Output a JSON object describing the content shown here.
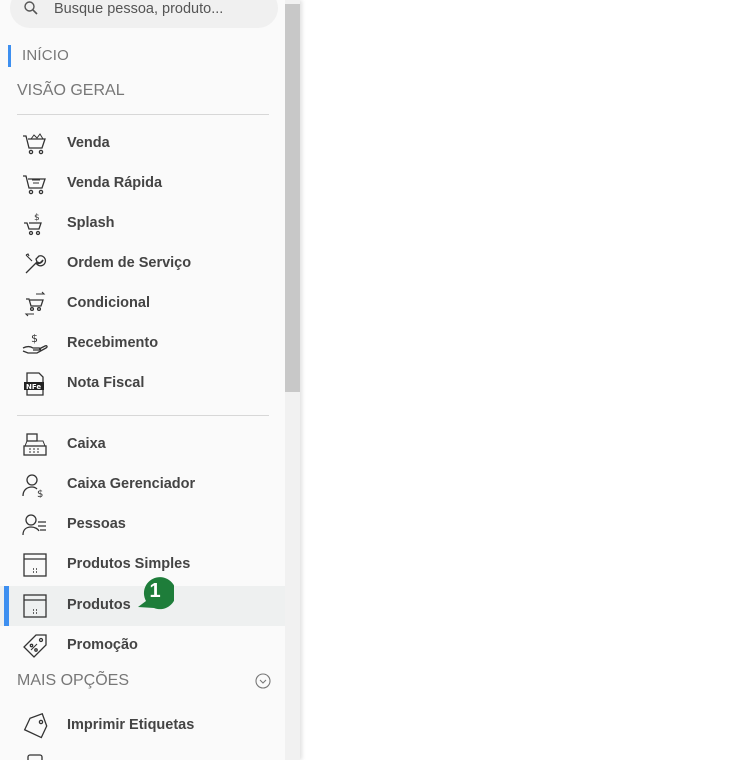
{
  "search": {
    "placeholder": "Busque pessoa, produto..."
  },
  "nav": {
    "inicio": "INÍCIO"
  },
  "sections": {
    "visao_geral": "VISÃO GERAL",
    "mais_opcoes": "MAIS OPÇÕES"
  },
  "group1": [
    {
      "label": "Venda",
      "icon": "cart-icon"
    },
    {
      "label": "Venda Rápida",
      "icon": "cart-fast-icon"
    },
    {
      "label": "Splash",
      "icon": "cart-dollar-icon"
    },
    {
      "label": "Ordem de Serviço",
      "icon": "wrench-icon"
    },
    {
      "label": "Condicional",
      "icon": "cart-exchange-icon"
    },
    {
      "label": "Recebimento",
      "icon": "hand-dollar-icon"
    },
    {
      "label": "Nota Fiscal",
      "icon": "nfe-icon"
    }
  ],
  "group2": [
    {
      "label": "Caixa",
      "icon": "cash-register-icon"
    },
    {
      "label": "Caixa Gerenciador",
      "icon": "user-dollar-icon"
    },
    {
      "label": "Pessoas",
      "icon": "user-list-icon"
    },
    {
      "label": "Produtos Simples",
      "icon": "box-icon"
    },
    {
      "label": "Produtos",
      "icon": "box-icon"
    },
    {
      "label": "Promoção",
      "icon": "tag-percent-icon"
    }
  ],
  "group3": [
    {
      "label": "Imprimir Etiquetas",
      "icon": "tag-icon"
    }
  ],
  "badge": {
    "number": "1",
    "color": "#1e7d3a"
  },
  "colors": {
    "accent": "#3d8ff0"
  }
}
